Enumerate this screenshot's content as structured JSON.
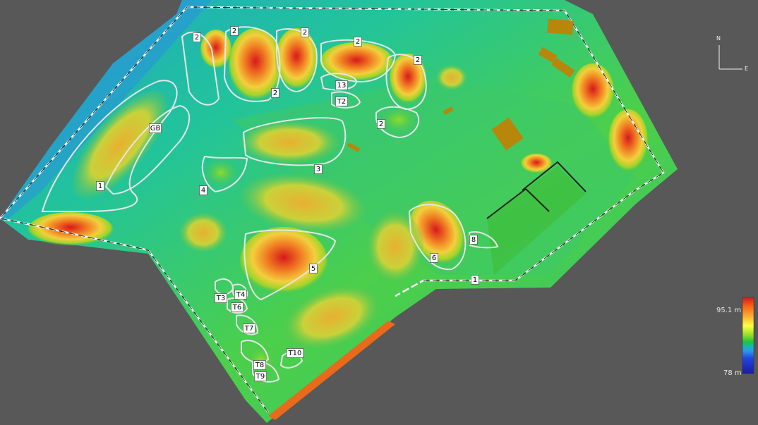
{
  "map": {
    "zone_labels": [
      "2",
      "2",
      "2",
      "2",
      "2",
      "2",
      "13",
      "T2",
      "2",
      "GB",
      "1",
      "3",
      "4",
      "5",
      "6",
      "8",
      "1",
      "T3",
      "T4",
      "T6",
      "T7",
      "T8",
      "T9",
      "T10"
    ],
    "legend": {
      "max_label": "95.1 m",
      "min_label": "78 m",
      "gradient": [
        "#d7191c",
        "#f56a16",
        "#fdae32",
        "#ffff3f",
        "#8fdc2a",
        "#22c43c",
        "#14b9a4",
        "#2a9bf2",
        "#2245dc",
        "#1a1aa8"
      ]
    },
    "compass": {
      "north": "N",
      "east": "E"
    },
    "colors": {
      "background": "#585858",
      "terrain_base": "#2cbf8a",
      "hill_high": "#e03a1c",
      "hill_mid": "#f0c040",
      "outline": "#e6e6e6",
      "label_box": "#ffffff"
    }
  }
}
